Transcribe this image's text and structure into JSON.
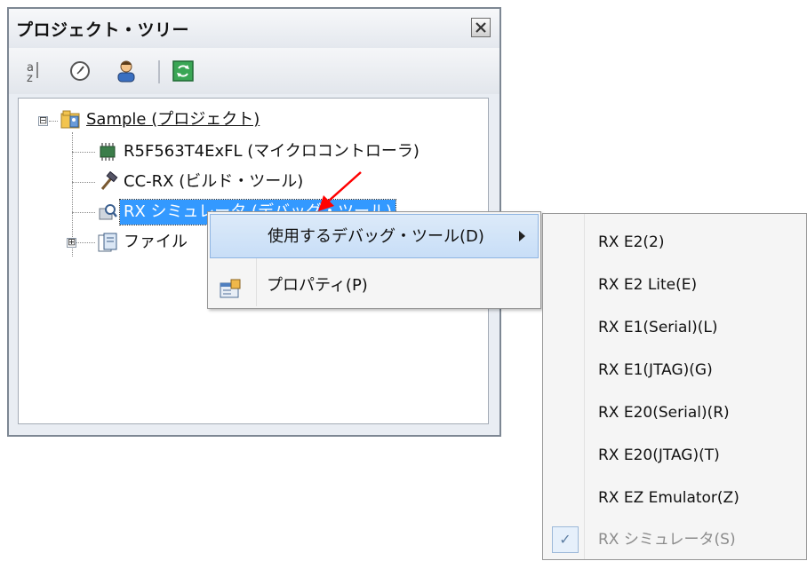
{
  "panel": {
    "title": "プロジェクト・ツリー",
    "close_icon": "close-icon",
    "toolbar": [
      "tree-expand-icon",
      "clock-icon",
      "person-icon",
      "refresh-icon"
    ]
  },
  "tree": {
    "root": {
      "label": "Sample (プロジェクト)",
      "icon": "project-icon",
      "expander": "⊟"
    },
    "children": [
      {
        "label": "R5F563T4ExFL (マイクロコントローラ)",
        "icon": "chip-icon"
      },
      {
        "label": "CC-RX (ビルド・ツール)",
        "icon": "hammer-icon"
      },
      {
        "label": "RX シミュレータ (デバッグ・ツール)",
        "icon": "debug-tool-icon",
        "selected": true
      },
      {
        "label": "ファイル",
        "icon": "file-folder-icon",
        "expander": "⊞"
      }
    ]
  },
  "context_menu": {
    "items": [
      {
        "label": "使用するデバッグ・ツール(D)",
        "has_submenu": true,
        "highlighted": true
      },
      {
        "label": "プロパティ(P)",
        "icon": "properties-icon"
      }
    ]
  },
  "submenu": {
    "items": [
      {
        "label": "RX E2(2)"
      },
      {
        "label": "RX E2 Lite(E)"
      },
      {
        "label": "RX E1(Serial)(L)"
      },
      {
        "label": "RX E1(JTAG)(G)"
      },
      {
        "label": "RX E20(Serial)(R)"
      },
      {
        "label": "RX E20(JTAG)(T)"
      },
      {
        "label": "RX EZ Emulator(Z)"
      },
      {
        "label": "RX シミュレータ(S)",
        "checked": true,
        "disabled": true
      }
    ],
    "check_mark": "✓"
  },
  "colors": {
    "selection": "#3399ff",
    "menu_highlight": "#c8def7",
    "arrow": "#ff0000"
  }
}
